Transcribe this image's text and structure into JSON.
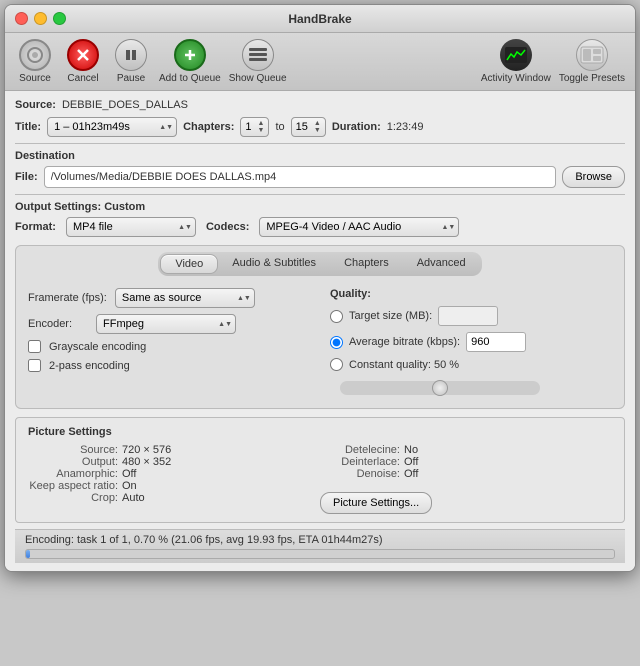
{
  "window": {
    "title": "HandBrake",
    "traffic_lights": [
      "close",
      "minimize",
      "maximize"
    ]
  },
  "toolbar": {
    "source_label": "Source",
    "cancel_label": "Cancel",
    "pause_label": "Pause",
    "add_label": "Add to Queue",
    "queue_label": "Show Queue",
    "activity_label": "Activity Window",
    "presets_label": "Toggle Presets"
  },
  "source": {
    "label": "Source:",
    "name": "DEBBIE_DOES_DALLAS"
  },
  "title_row": {
    "title_label": "Title:",
    "title_value": "1 – 01h23m49s",
    "chapters_label": "Chapters:",
    "chapters_from": "1",
    "chapters_to": "15",
    "duration_label": "Duration:",
    "duration_value": "1:23:49"
  },
  "destination": {
    "section_label": "Destination",
    "file_label": "File:",
    "file_path": "/Volumes/Media/DEBBIE DOES DALLAS.mp4",
    "browse_label": "Browse"
  },
  "output_settings": {
    "section_label": "Output Settings: Custom",
    "format_label": "Format:",
    "format_value": "MP4 file",
    "codecs_label": "Codecs:",
    "codecs_value": "MPEG-4 Video / AAC Audio"
  },
  "tabs": {
    "video_label": "Video",
    "audio_label": "Audio & Subtitles",
    "chapters_label": "Chapters",
    "advanced_label": "Advanced",
    "active": "Video"
  },
  "video_tab": {
    "framerate_label": "Framerate (fps):",
    "framerate_value": "Same as source",
    "encoder_label": "Encoder:",
    "encoder_value": "FFmpeg",
    "grayscale_label": "Grayscale encoding",
    "twopass_label": "2-pass encoding",
    "quality_label": "Quality:",
    "target_size_label": "Target size (MB):",
    "avg_bitrate_label": "Average bitrate (kbps):",
    "avg_bitrate_value": "960",
    "constant_quality_label": "Constant quality: 50 %",
    "slider_value": 50
  },
  "picture_settings": {
    "section_label": "Picture Settings",
    "source_label": "Source:",
    "source_value": "720 × 576",
    "output_label": "Output:",
    "output_value": "480 × 352",
    "anamorphic_label": "Anamorphic:",
    "anamorphic_value": "Off",
    "keep_aspect_label": "Keep aspect ratio:",
    "keep_aspect_value": "On",
    "crop_label": "Crop:",
    "crop_value": "Auto",
    "detelecine_label": "Detelecine:",
    "detelecine_value": "No",
    "deinterlace_label": "Deinterlace:",
    "deinterlace_value": "Off",
    "denoise_label": "Denoise:",
    "denoise_value": "Off",
    "btn_label": "Picture Settings..."
  },
  "status": {
    "text": "Encoding: task 1 of 1, 0.70 % (21.06 fps, avg 19.93 fps, ETA 01h44m27s)",
    "progress": 0.7
  }
}
